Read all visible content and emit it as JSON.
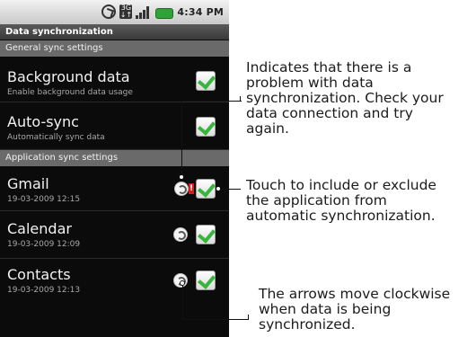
{
  "status_bar": {
    "time": "4:34 PM",
    "icons": [
      "sync-status-icon",
      "3g-network-icon",
      "signal-strength-icon",
      "battery-icon"
    ]
  },
  "screen": {
    "title": "Data synchronization",
    "general_section": "General sync settings",
    "app_section": "Application sync settings",
    "rows": [
      {
        "title": "Background data",
        "subtitle": "Enable background data usage",
        "checked": true
      },
      {
        "title": "Auto-sync",
        "subtitle": "Automatically sync data",
        "checked": true
      },
      {
        "title": "Gmail",
        "subtitle": "19-03-2009 12:15",
        "checked": true,
        "sync_status": "problem"
      },
      {
        "title": "Calendar",
        "subtitle": "19-03-2009 12:09",
        "checked": true,
        "sync_status": "ok"
      },
      {
        "title": "Contacts",
        "subtitle": "19-03-2009 12:13",
        "checked": true,
        "sync_status": "ok"
      }
    ]
  },
  "callouts": {
    "problem": [
      "Indicates that there is a",
      "problem with data",
      "synchronization. Check your",
      "data connection and try",
      "again."
    ],
    "toggle": [
      "Touch to include or exclude",
      "the application from",
      "automatic synchronization."
    ],
    "arrows": [
      "The arrows move clockwise",
      "when data is being",
      "synchronized."
    ]
  },
  "colors": {
    "check_green": "#38b53d",
    "alert_red": "#d01f1f",
    "screen_bg": "#0b0b0b",
    "section_bg": "#6a6a6a"
  }
}
